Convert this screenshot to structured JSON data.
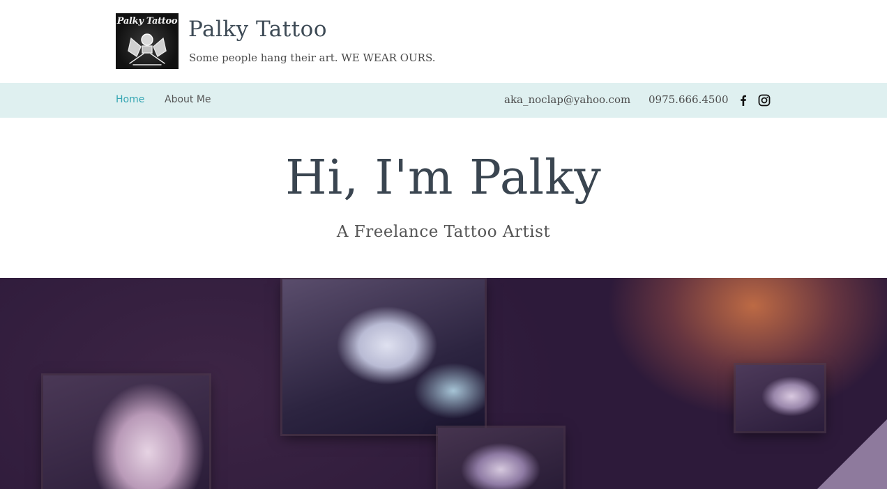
{
  "header": {
    "logo_text": "Palky Tattoo",
    "site_title": "Palky Tattoo",
    "tagline": "Some people hang their art. WE WEAR OURS."
  },
  "nav": {
    "items": [
      {
        "label": "Home",
        "active": true
      },
      {
        "label": "About Me",
        "active": false
      }
    ]
  },
  "contact": {
    "email": "aka_noclap@yahoo.com",
    "phone": "0975.666.4500"
  },
  "social": [
    {
      "icon": "facebook-icon"
    },
    {
      "icon": "instagram-icon"
    }
  ],
  "intro": {
    "heading": "Hi, I'm Palky",
    "subheading": "A Freelance Tattoo Artist"
  },
  "colors": {
    "accent": "#35a6b3",
    "navbar_bg": "#dff0f0",
    "heading": "#3a4550",
    "hero_bg": "#2b1938"
  }
}
